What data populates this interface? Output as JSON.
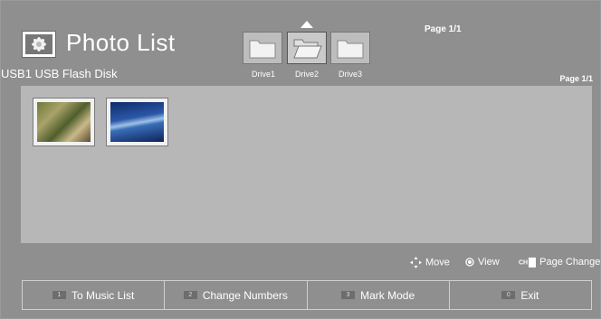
{
  "header": {
    "title": "Photo List",
    "page_indicator": "Page 1/1"
  },
  "source": {
    "label": "USB1 USB Flash Disk"
  },
  "drives": [
    {
      "label": "Drive1",
      "selected": false
    },
    {
      "label": "Drive2",
      "selected": true
    },
    {
      "label": "Drive3",
      "selected": false
    }
  ],
  "content": {
    "page_indicator": "Page 1/1",
    "photos": [
      {
        "name": "photo-thumbnail-1"
      },
      {
        "name": "photo-thumbnail-2"
      }
    ]
  },
  "hints": {
    "move": "Move",
    "view": "View",
    "ch_badge": "CH",
    "page_change": "Page Change"
  },
  "bottom_buttons": [
    {
      "key": "1",
      "label": "To Music List"
    },
    {
      "key": "2",
      "label": "Change Numbers"
    },
    {
      "key": "3",
      "label": "Mark Mode"
    },
    {
      "key": "0",
      "label": "Exit"
    }
  ],
  "colors": {
    "background": "#8f8f8f",
    "content_area": "#b7b7b7",
    "text": "#ffffff"
  }
}
